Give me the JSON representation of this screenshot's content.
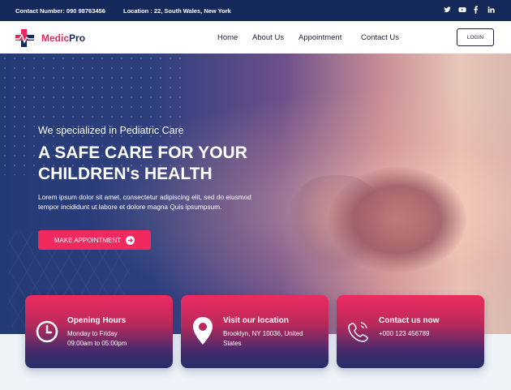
{
  "topbar": {
    "contact": "Contact Number: 090 98763456",
    "location": "Location : 22, South Wales, New York",
    "social": [
      "twitter-icon",
      "youtube-icon",
      "facebook-icon",
      "linkedin-icon"
    ]
  },
  "header": {
    "logo_part1": "Medic",
    "logo_part2": "Pro",
    "nav": [
      "Home",
      "About Us",
      "Appointment",
      "Contact Us"
    ],
    "login": "LOGIN"
  },
  "hero": {
    "subtitle": "We specialized in Pediatric Care",
    "title_line1": "A SAFE CARE FOR YOUR",
    "title_line2": "CHILDREN's HEALTH",
    "description": "Lorem ipsum dolor sit amet, consectetur adipiscing elit, sed do eiusmod tempor incididunt ut labore et dolore magna Quis ipsumpsum.",
    "cta": "MAKE APPOINTMENT"
  },
  "cards": [
    {
      "title": "Opening Hours",
      "line1": "Monday to Friday",
      "line2": "09:00am to 05:00pm",
      "icon": "clock-icon"
    },
    {
      "title": "Visit our location",
      "line1": "Brooklyn, NY 10036, United",
      "line2": "States",
      "icon": "map-pin-icon"
    },
    {
      "title": "Contact us now",
      "line1": "+000 123 456789",
      "line2": "",
      "icon": "phone-icon"
    }
  ],
  "colors": {
    "navy": "#14285a",
    "accent": "#ee2a5e"
  }
}
